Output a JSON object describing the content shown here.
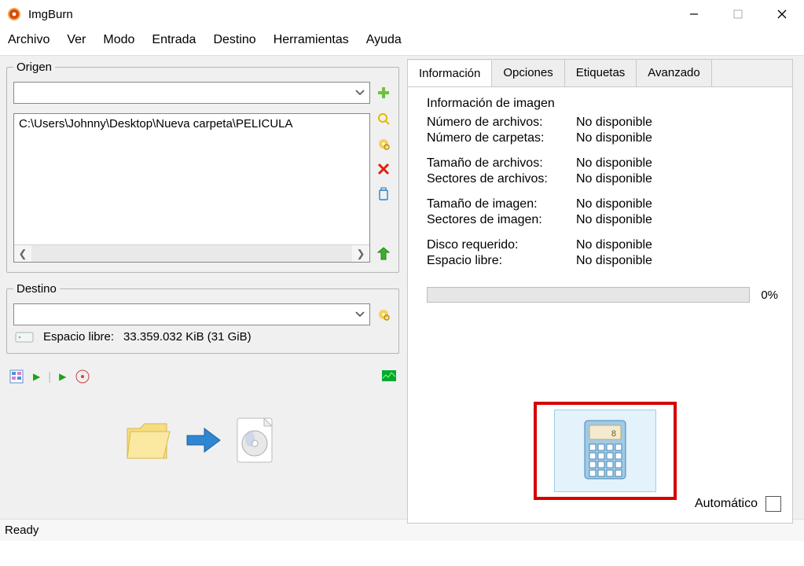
{
  "window": {
    "title": "ImgBurn"
  },
  "menu": {
    "archivo": "Archivo",
    "ver": "Ver",
    "modo": "Modo",
    "entrada": "Entrada",
    "destino": "Destino",
    "herramientas": "Herramientas",
    "ayuda": "Ayuda"
  },
  "origen": {
    "label": "Origen",
    "combo_value": "",
    "path": "C:\\Users\\Johnny\\Desktop\\Nueva carpeta\\PELICULA"
  },
  "destino": {
    "label": "Destino",
    "combo_value": "",
    "free_label": "Espacio libre:",
    "free_value": "33.359.032 KiB  (31 GiB)"
  },
  "tabs": {
    "informacion": "Información",
    "opciones": "Opciones",
    "etiquetas": "Etiquetas",
    "avanzado": "Avanzado"
  },
  "info": {
    "header": "Información de imagen",
    "nfiles_k": "Número de archivos:",
    "nfiles_v": "No disponible",
    "nfolders_k": "Número de carpetas:",
    "nfolders_v": "No disponible",
    "fsize_k": "Tamaño de archivos:",
    "fsize_v": "No disponible",
    "fsect_k": "Sectores de archivos:",
    "fsect_v": "No disponible",
    "isize_k": "Tamaño de imagen:",
    "isize_v": "No disponible",
    "isect_k": "Sectores de imagen:",
    "isect_v": "No disponible",
    "disk_k": "Disco requerido:",
    "disk_v": "No disponible",
    "free_k": "Espacio libre:",
    "free_v": "No disponible",
    "pct": "0%",
    "auto": "Automático"
  },
  "status": {
    "text": "Ready"
  },
  "icons": {
    "add": "add-icon",
    "search": "search-icon",
    "dsearch": "disc-search-icon",
    "delete": "delete-icon",
    "recycle": "recycle-icon",
    "up": "up-folder-icon"
  }
}
